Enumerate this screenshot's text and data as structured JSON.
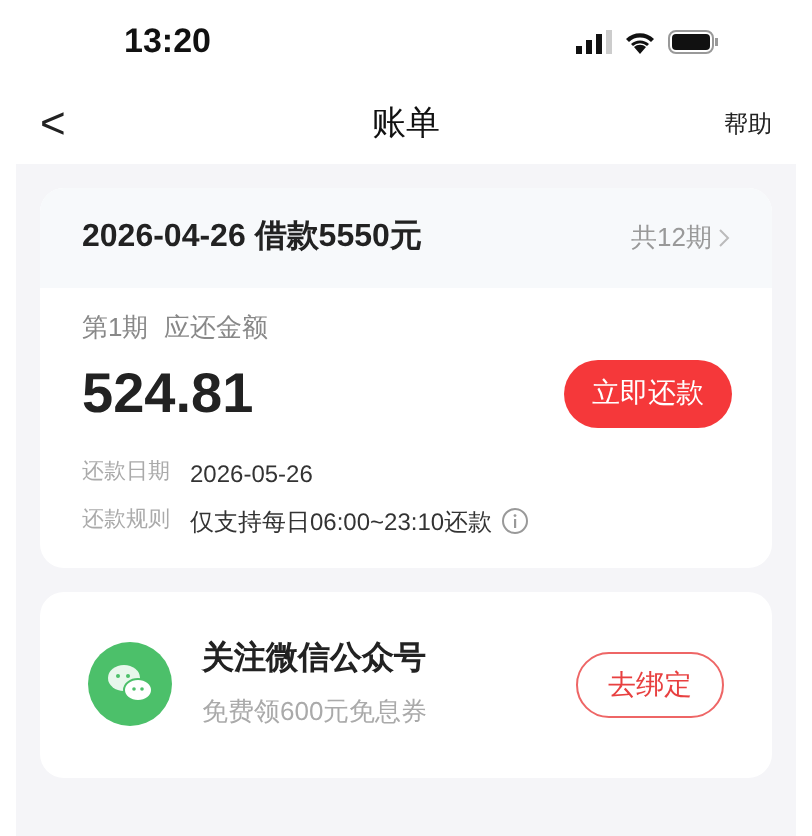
{
  "status_bar": {
    "time": "13:20"
  },
  "nav": {
    "back": "<",
    "title": "账单",
    "help": "帮助"
  },
  "bill": {
    "loan": "2026-04-26 借款5550元",
    "periods": "共12期",
    "period_label": "第1期",
    "due_label": "应还金额",
    "amount": "524.81",
    "pay_button": "立即还款",
    "details": [
      {
        "label": "还款日期",
        "value": "2026-05-26",
        "info": false
      },
      {
        "label": "还款规则",
        "value": "仅支持每日06:00~23:10还款",
        "info": true
      }
    ]
  },
  "promo": {
    "title": "关注微信公众号",
    "subtitle": "免费领600元免息券",
    "button": "去绑定"
  }
}
